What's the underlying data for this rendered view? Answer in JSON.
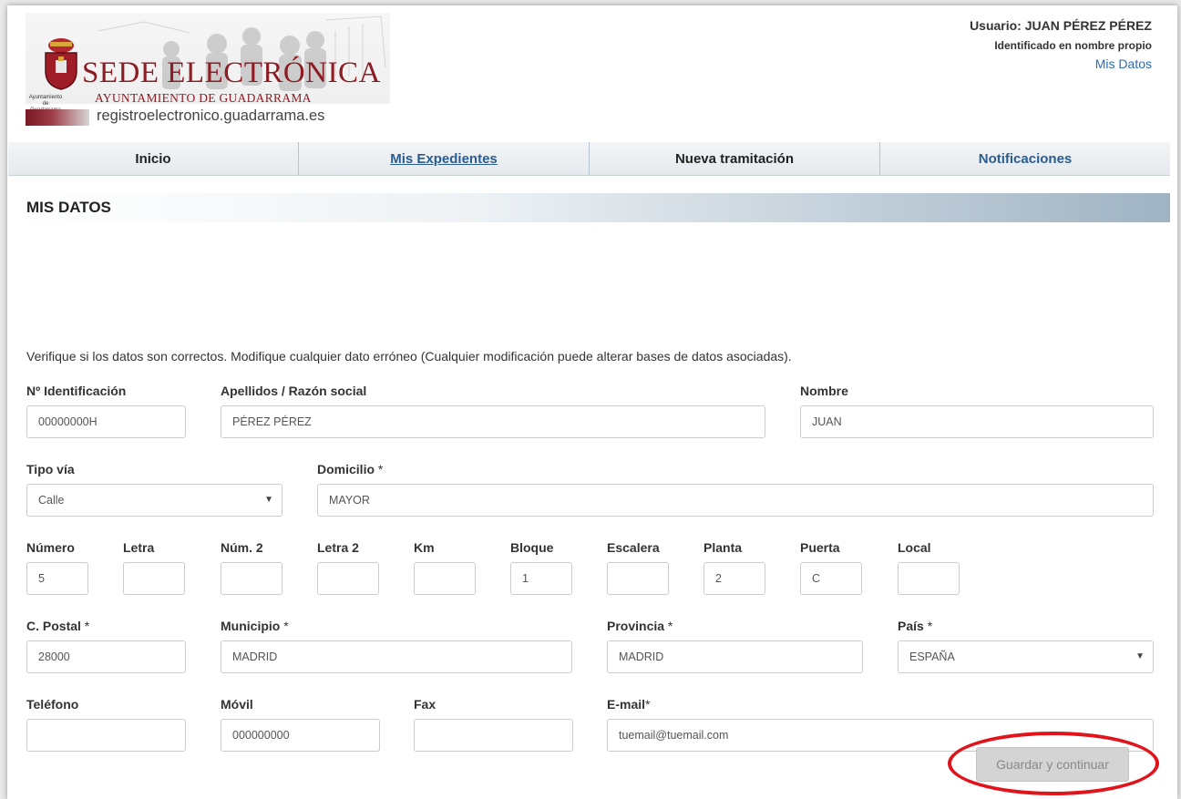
{
  "header": {
    "logo": {
      "title": "SEDE ELECTRÓNICA",
      "subtitle": "AYUNTAMIENTO DE GUADARRAMA",
      "small_text": "Ayuntamiento de Guadarrama",
      "url": "registroelectronico.guadarrama.es"
    },
    "user": {
      "name": "Usuario: JUAN PÉREZ PÉREZ",
      "identification": "Identificado en nombre propio",
      "my_data_link": "Mis Datos"
    }
  },
  "nav": {
    "items": [
      {
        "label": "Inicio"
      },
      {
        "label": "Mis Expedientes"
      },
      {
        "label": "Nueva tramitación"
      },
      {
        "label": "Notificaciones"
      }
    ]
  },
  "section": {
    "title": "MIS DATOS"
  },
  "form": {
    "intro": "Verifique si los datos son correctos. Modifique cualquier dato erróneo (Cualquier modificación puede alterar bases de datos asociadas).",
    "required_mark": "*",
    "id_number": {
      "label": "Nº Identificación",
      "value": "00000000H"
    },
    "surnames": {
      "label": "Apellidos / Razón social",
      "value": "PÉREZ PÉREZ"
    },
    "name": {
      "label": "Nombre",
      "value": "JUAN"
    },
    "street_type": {
      "label": "Tipo vía",
      "value": "Calle"
    },
    "address": {
      "label": "Domicilio",
      "value": "MAYOR"
    },
    "number": {
      "label": "Número",
      "value": "5"
    },
    "letter": {
      "label": "Letra",
      "value": ""
    },
    "number2": {
      "label": "Núm. 2",
      "value": ""
    },
    "letter2": {
      "label": "Letra 2",
      "value": ""
    },
    "km": {
      "label": "Km",
      "value": ""
    },
    "block": {
      "label": "Bloque",
      "value": "1"
    },
    "stair": {
      "label": "Escalera",
      "value": ""
    },
    "floor": {
      "label": "Planta",
      "value": "2"
    },
    "door": {
      "label": "Puerta",
      "value": "C"
    },
    "local": {
      "label": "Local",
      "value": ""
    },
    "postal_code": {
      "label": "C. Postal",
      "value": "28000"
    },
    "municipality": {
      "label": "Municipio",
      "value": "MADRID"
    },
    "province": {
      "label": "Provincia",
      "value": "MADRID"
    },
    "country": {
      "label": "País",
      "value": "ESPAÑA"
    },
    "phone": {
      "label": "Teléfono",
      "value": ""
    },
    "mobile": {
      "label": "Móvil",
      "value": "000000000"
    },
    "fax": {
      "label": "Fax",
      "value": ""
    },
    "email": {
      "label": "E-mail",
      "value": "tuemail@tuemail.com"
    },
    "submit_label": "Guardar y continuar"
  },
  "colors": {
    "brand_red": "#8d1c24",
    "link_blue": "#2a6cb0",
    "highlight_circle": "#e1141b"
  },
  "icons": {
    "dropdown": "chevron-down-icon"
  }
}
